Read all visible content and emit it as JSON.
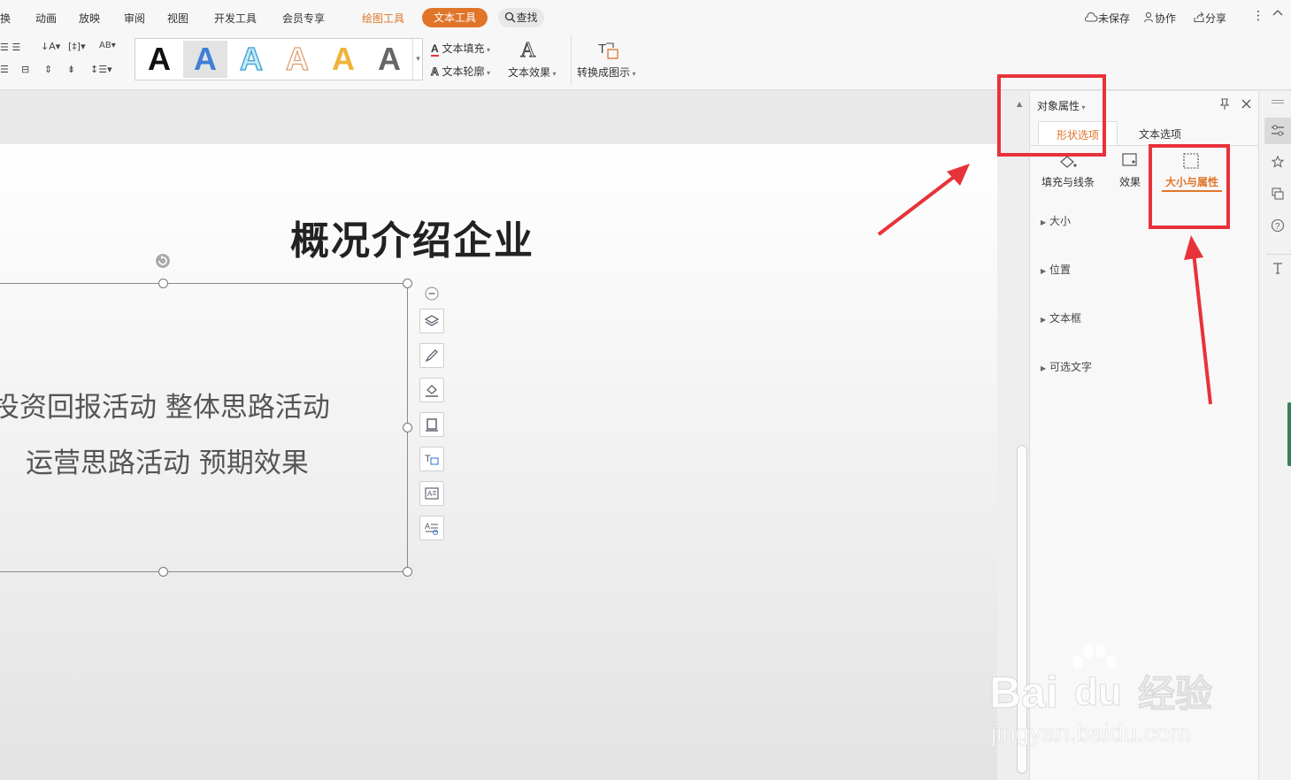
{
  "menubar": {
    "items": [
      "换",
      "动画",
      "放映",
      "审阅",
      "视图",
      "开发工具",
      "会员专享"
    ],
    "drawing_tools": "绘图工具",
    "text_tools": "文本工具",
    "search": "查找",
    "unsaved": "未保存",
    "collab": "协作",
    "share": "分享"
  },
  "ribbon": {
    "text_fill": "文本填充",
    "text_outline": "文本轮廓",
    "text_effect": "文本效果",
    "convert_to_diagram": "转换成图示",
    "gallery_letters": [
      "A",
      "A",
      "A",
      "A",
      "A",
      "A"
    ]
  },
  "slide": {
    "title": "概况介绍企业",
    "lines": [
      "投资回报活动 整体思路活动",
      "运营思路活动 预期效果"
    ]
  },
  "pane": {
    "title": "对象属性",
    "tabs": [
      "形状选项",
      "文本选项"
    ],
    "subtabs": [
      "填充与线条",
      "效果",
      "大小与属性"
    ],
    "sections": [
      "大小",
      "位置",
      "文本框",
      "可选文字"
    ]
  },
  "watermark": {
    "brand": "Bai",
    "brand2": "du",
    "cn": "经验",
    "url": "jingyan.baidu.com"
  },
  "colors": {
    "accent_orange": "#e0752a",
    "annotation_red": "#e8323a"
  }
}
